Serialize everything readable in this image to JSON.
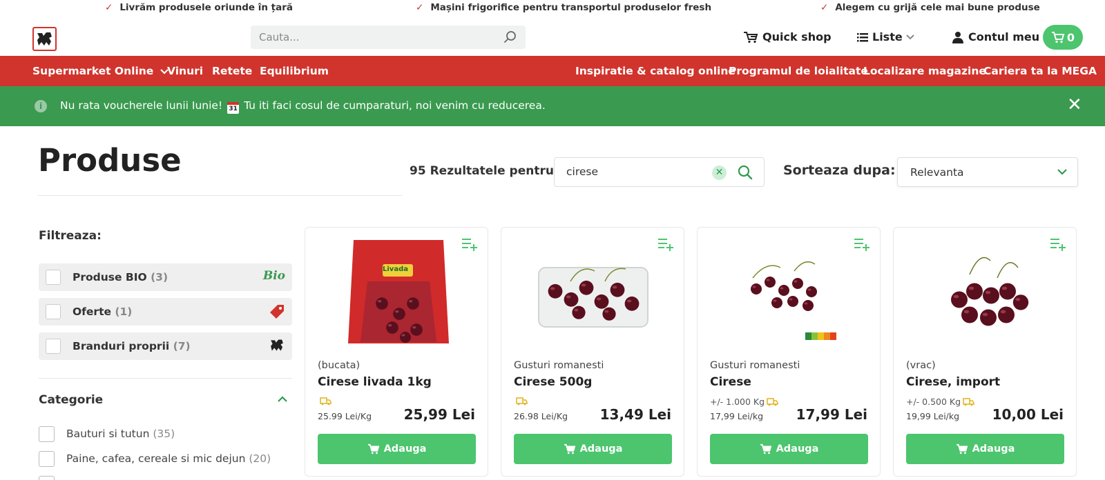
{
  "promises": [
    "Livrăm produsele oriunde în țară",
    "Mașini frigorifice pentru transportul produselor fresh",
    "Alegem cu grijă cele mai bune produse"
  ],
  "header": {
    "logo_text": "MEGA IMAGE",
    "search_placeholder": "Cauta...",
    "quick_shop": "Quick shop",
    "lists": "Liste",
    "account": "Contul meu",
    "cart_count": "0"
  },
  "nav": {
    "left": [
      "Supermarket Online",
      "Vinuri",
      "Retete",
      "Equilibrium"
    ],
    "right": [
      "Inspiratie & catalog online",
      "Programul de loialitate",
      "Localizare magazine",
      "Cariera ta la MEGA"
    ]
  },
  "notice": {
    "text_before": "Nu rata voucherele lunii Iunie!",
    "calendar": "31",
    "text_after": "Tu iti faci cosul de cumparaturi, noi venim cu reducerea."
  },
  "page": {
    "title": "Produse",
    "results_label": "95 Rezultatele pentru",
    "query": "cirese",
    "sort_label": "Sorteaza dupa:",
    "sort_value": "Relevanta"
  },
  "filters": {
    "title": "Filtreaza:",
    "items": [
      {
        "label": "Produse BIO",
        "count": "(3)",
        "badge": "Bio"
      },
      {
        "label": "Oferte",
        "count": "(1)"
      },
      {
        "label": "Branduri proprii",
        "count": "(7)"
      }
    ]
  },
  "category": {
    "title": "Categorie",
    "items": [
      {
        "label": "Bauturi si tutun",
        "count": "(35)"
      },
      {
        "label": "Paine, cafea, cereale si mic dejun",
        "count": "(20)"
      }
    ]
  },
  "products": [
    {
      "brand": "(bucata)",
      "name": "Cirese livada 1kg",
      "meta": "",
      "unit_price": "25.99 Lei/Kg",
      "price": "25,99 Lei",
      "add": "Adauga",
      "pack_label": "Livada"
    },
    {
      "brand": "Gusturi romanesti",
      "name": "Cirese 500g",
      "meta": "",
      "unit_price": "26.98 Lei/Kg",
      "price": "13,49 Lei",
      "add": "Adauga"
    },
    {
      "brand": "Gusturi romanesti",
      "name": "Cirese",
      "meta": "+/- 1.000 Kg",
      "unit_price": "17,99 Lei/kg",
      "price": "17,99 Lei",
      "add": "Adauga"
    },
    {
      "brand": "(vrac)",
      "name": "Cirese, import",
      "meta": "+/- 0.500 Kg",
      "unit_price": "19,99 Lei/kg",
      "price": "10,00 Lei",
      "add": "Adauga"
    }
  ],
  "colors": {
    "brand_red": "#d0342c",
    "brand_green": "#4cc56e",
    "notice_green": "#3a9a50"
  }
}
